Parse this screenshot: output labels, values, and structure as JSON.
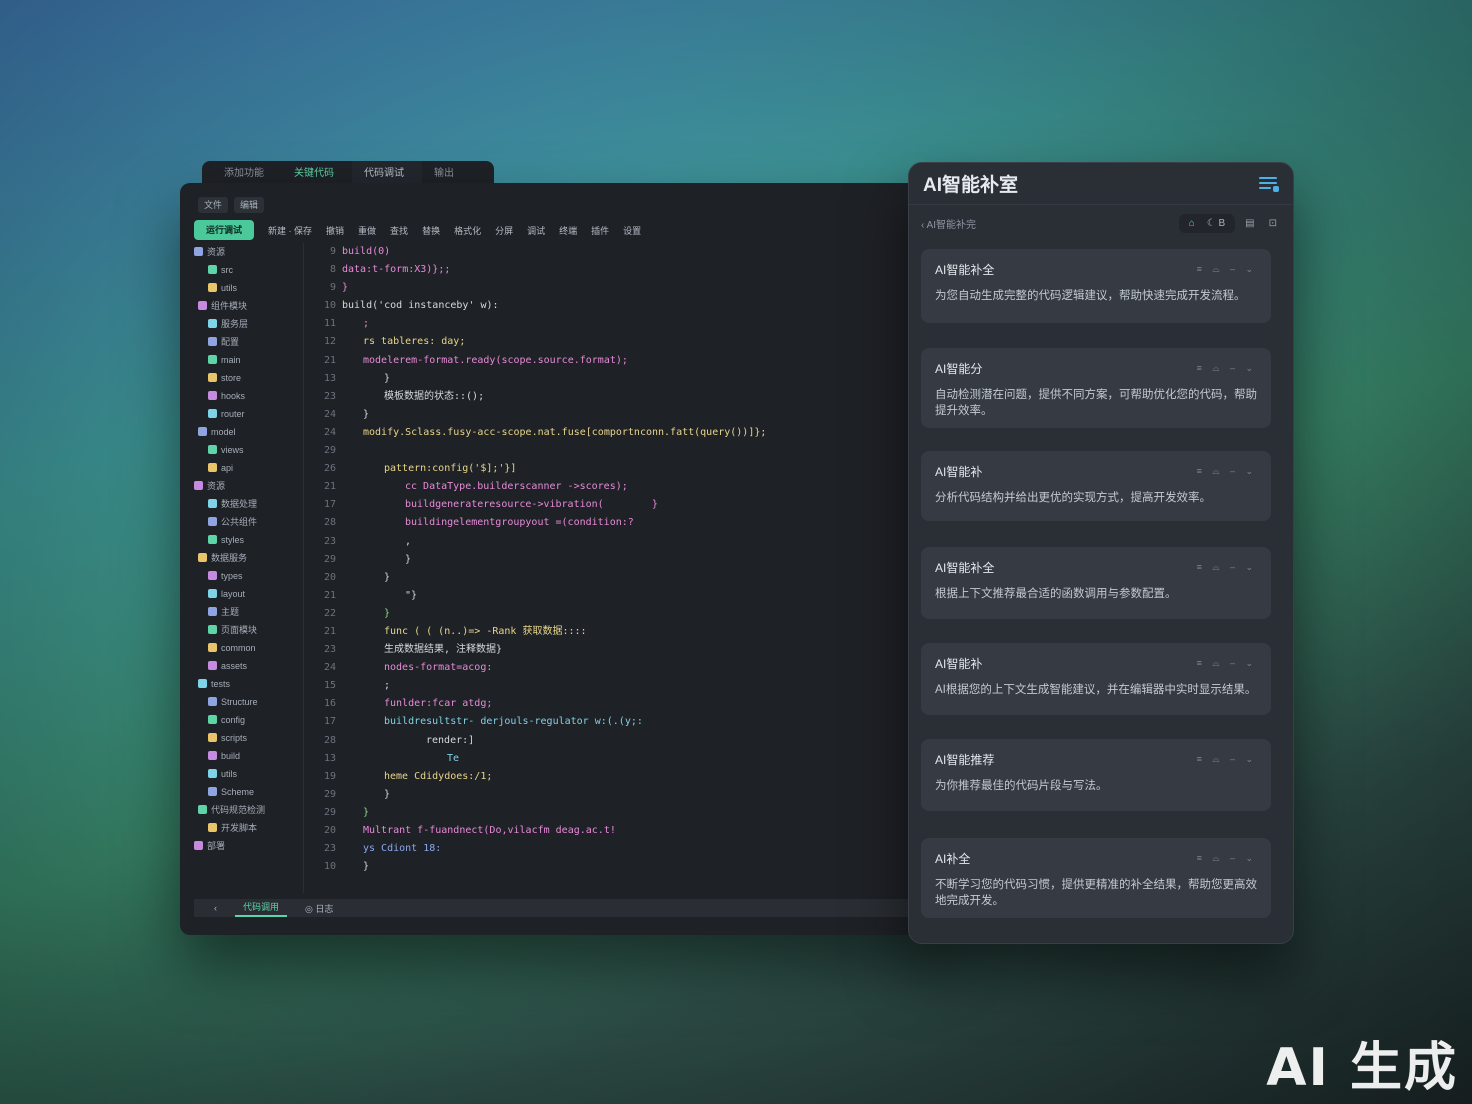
{
  "editor": {
    "tabs": [
      "添加功能",
      "关键代码",
      "代码调试",
      "输出"
    ],
    "toolbar1": [
      "文件",
      "编辑"
    ],
    "run_label": "运行调试",
    "toolbar2": [
      "新建 · 保存",
      "撤销",
      "重做",
      "查找",
      "替换",
      "格式化",
      "分屏",
      "调试",
      "终端",
      "插件",
      "设置"
    ],
    "sidebar": [
      "资源",
      "src",
      "utils",
      "组件模块",
      "服务层",
      "配置",
      "main",
      "store",
      "hooks",
      "router",
      "model",
      "views",
      "api",
      "资源",
      "数据处理",
      "公共组件",
      "styles",
      "数据服务",
      "types",
      "layout",
      "主题",
      "页面模块",
      "common",
      "assets",
      "tests",
      "Structure",
      "config",
      "scripts",
      "build",
      "utils",
      "Scheme",
      "代码规范检测",
      "开发脚本",
      "部署"
    ],
    "line_numbers": [
      "9",
      "8",
      "9",
      "10",
      "11",
      "12",
      "21",
      "13",
      "23",
      "24",
      "24",
      "29",
      "26",
      "21",
      "17",
      "28",
      "23",
      "29",
      "20",
      "21",
      "22",
      "21",
      "23",
      "24",
      "15",
      "16",
      "17",
      "28",
      "13",
      "19",
      "29",
      "29",
      "20",
      "23",
      "10"
    ],
    "code": [
      {
        "t": "build(0)",
        "c": "c-pink",
        "i": 0
      },
      {
        "t": "data:t-form:X3)};;",
        "c": "c-pink",
        "i": 0
      },
      {
        "t": "}",
        "c": "c-pink",
        "i": 0
      },
      {
        "t": "build('cod instanceby' w):",
        "c": "c-white",
        "i": 0
      },
      {
        "t": ";",
        "c": "c-pink",
        "i": 2
      },
      {
        "t": "rs tableres: day;",
        "c": "c-yel",
        "i": 2
      },
      {
        "t": "modelerem-format.ready(scope.source.format);",
        "c": "c-pink",
        "i": 2
      },
      {
        "t": "}",
        "c": "c-white",
        "i": 4
      },
      {
        "t": "模板数据的状态::();",
        "c": "c-white",
        "i": 4
      },
      {
        "t": "}",
        "c": "c-white",
        "i": 2
      },
      {
        "t": "modify.Sclass.fusy-acc-scope.nat.fuse[comportnconn.fatt(query())]};",
        "c": "c-yel",
        "i": 2
      },
      {
        "t": "",
        "c": "c-white",
        "i": 0
      },
      {
        "t": "pattern:config('$];'}]",
        "c": "c-yel",
        "i": 4
      },
      {
        "t": "cc DataType.builderscanner ->scores);",
        "c": "c-pink",
        "i": 6
      },
      {
        "t": "buildgenerateresource->vibration(        }",
        "c": "c-pink",
        "i": 6
      },
      {
        "t": "buildingelementgroupyout =(condition:?",
        "c": "c-pink",
        "i": 6
      },
      {
        "t": ",",
        "c": "c-white",
        "i": 6
      },
      {
        "t": "}",
        "c": "c-white",
        "i": 6
      },
      {
        "t": "}",
        "c": "c-white",
        "i": 4
      },
      {
        "t": "\"}",
        "c": "c-white",
        "i": 6
      },
      {
        "t": "}",
        "c": "c-green",
        "i": 4
      },
      {
        "t": "func ( ( (n..)=> -Rank 获取数据::::",
        "c": "c-yel",
        "i": 4
      },
      {
        "t": "生成数据结果, 注释数据}",
        "c": "c-white",
        "i": 4
      },
      {
        "t": "nodes-format=acog:",
        "c": "c-pink",
        "i": 4
      },
      {
        "t": ";",
        "c": "c-white",
        "i": 4
      },
      {
        "t": "funlder:fcar atdg;",
        "c": "c-pink",
        "i": 4
      },
      {
        "t": "buildresultstr- derjouls-regulator w:(.(y;:",
        "c": "c-cyan",
        "i": 4
      },
      {
        "t": "render:]",
        "c": "c-white",
        "i": 8
      },
      {
        "t": "Te",
        "c": "c-cyan",
        "i": 10
      },
      {
        "t": "heme Cdidydoes:/1;",
        "c": "c-yel",
        "i": 4
      },
      {
        "t": "}",
        "c": "c-white",
        "i": 4
      },
      {
        "t": "}",
        "c": "c-green",
        "i": 2
      },
      {
        "t": "Multrant f-fuandnect(Do,vilacfm deag.ac.t!",
        "c": "c-pink",
        "i": 2
      },
      {
        "t": "ys Cdiont 18:",
        "c": "c-blue",
        "i": 2
      },
      {
        "t": "}",
        "c": "c-white",
        "i": 2
      }
    ],
    "bottom_tabs": [
      "‹",
      "代码调用",
      "◎  日志"
    ]
  },
  "ai": {
    "title": "AI智能补室",
    "crumb": "‹  AI智能补完",
    "tools": [
      "⌂",
      "☾ B",
      "▤",
      "⊡"
    ],
    "card_actions": "≡ ⌓ – ⌄",
    "cards": [
      {
        "title": "AI智能补全",
        "body": "为您自动生成完整的代码逻辑建议，帮助快速完成开发流程。"
      },
      {
        "title": "AI智能分",
        "body": "自动检测潜在问题，提供不同方案，可帮助优化您的代码，帮助提升效率。"
      },
      {
        "title": "AI智能补",
        "body": "分析代码结构并给出更优的实现方式，提高开发效率。"
      },
      {
        "title": "AI智能补全",
        "body": "根据上下文推荐最合适的函数调用与参数配置。"
      },
      {
        "title": "AI智能补",
        "body": "AI根据您的上下文生成智能建议，并在编辑器中实时显示结果。"
      },
      {
        "title": "AI智能推荐",
        "body": "为你推荐最佳的代码片段与写法。"
      },
      {
        "title": "AI补全",
        "body": "不断学习您的代码习惯，提供更精准的补全结果，帮助您更高效地完成开发。"
      }
    ]
  },
  "watermark": "AI 生成"
}
